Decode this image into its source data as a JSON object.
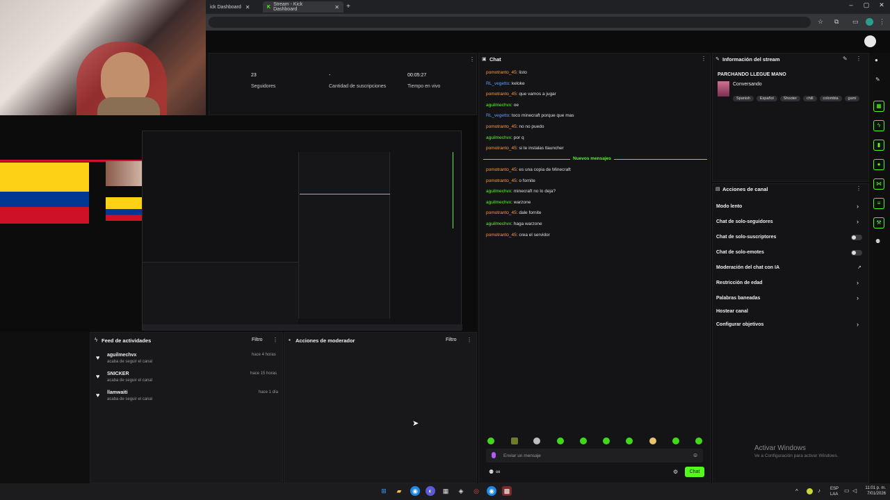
{
  "browser": {
    "tabs": [
      {
        "label": "ick Dashboard"
      },
      {
        "label": "Stream - Kick Dashboard"
      }
    ],
    "new_tab": "+",
    "controls": {
      "minimize": "–",
      "maximize": "▢",
      "close": "✕"
    }
  },
  "stats": {
    "followers_value": "23",
    "followers_label": "Seguidores",
    "subs_value": "-",
    "subs_label": "Cantidad de suscripciones",
    "live_time_value": "00:05:27",
    "live_time_label": "Tiempo en vivo"
  },
  "chat": {
    "title": "Chat",
    "new_messages_label": "Nuevos mensajes",
    "lines_before": [
      {
        "user": "pomotranto_45",
        "color": "orange",
        "text": "listo"
      },
      {
        "user": "RL_vegetto",
        "color": "blue",
        "text": "keloke"
      },
      {
        "user": "pomotranto_45",
        "color": "orange",
        "text": "que vamos a jugar"
      },
      {
        "user": "aguilmechvx",
        "color": "green",
        "text": "oe"
      },
      {
        "user": "RL_vegetto",
        "color": "blue",
        "text": "toco minecraft porque que mas"
      },
      {
        "user": "pomotranto_45",
        "color": "orange",
        "text": "no no puedo"
      },
      {
        "user": "aguilmechvx",
        "color": "green",
        "text": "por q"
      },
      {
        "user": "pomotranto_45",
        "color": "orange",
        "text": "si te instalas tlauncher"
      }
    ],
    "lines_after": [
      {
        "user": "pomotranto_45",
        "color": "orange",
        "text": "es una copia de Minecraft"
      },
      {
        "user": "pomotranto_45",
        "color": "orange",
        "text": "o fornite"
      },
      {
        "user": "aguilmechvx",
        "color": "green",
        "text": "minecraft no lo deja?"
      },
      {
        "user": "aguilmechvx",
        "color": "green",
        "text": "warzone"
      },
      {
        "user": "pomotranto_45",
        "color": "orange",
        "text": "dale fornite"
      },
      {
        "user": "aguilmechvx",
        "color": "green",
        "text": "haga warzone"
      },
      {
        "user": "pomotranto_45",
        "color": "orange",
        "text": "crea el servidor"
      }
    ],
    "input_placeholder": "Enviar un mensaje",
    "send_label": "Chat",
    "infinity": "∞"
  },
  "stream_info": {
    "title": "Información del stream",
    "stream_name": "PARCHANDO LLEGUE MANO",
    "category": "Conversando",
    "tags": [
      "Spanish",
      "Español",
      "Shooter",
      "chill",
      "colombia",
      "gami"
    ]
  },
  "channel_actions": {
    "title": "Acciones de canal",
    "items": [
      {
        "label": "Modo lento",
        "control": "chevron"
      },
      {
        "label": "Chat de solo-seguidores",
        "control": "chevron"
      },
      {
        "label": "Chat de solo-suscriptores",
        "control": "toggle"
      },
      {
        "label": "Chat de solo-emotes",
        "control": "toggle"
      },
      {
        "label": "Moderación del chat con IA",
        "control": "external"
      },
      {
        "label": "Restricción de edad",
        "control": "chevron"
      },
      {
        "label": "Palabras baneadas",
        "control": "chevron"
      },
      {
        "label": "Hostear canal",
        "control": "none"
      },
      {
        "label": "Configurar objetivos",
        "control": "chevron"
      }
    ]
  },
  "activity_feed": {
    "title": "Feed de actividades",
    "filter": "Filtro",
    "items": [
      {
        "name": "aguilmechvx",
        "action": "acaba de seguir el canal",
        "time": "hace 4 horas"
      },
      {
        "name": "SNICKER",
        "action": "acaba de seguir el canal",
        "time": "hace 15 horas"
      },
      {
        "name": "llamwaiti",
        "action": "acaba de seguir el canal",
        "time": "hace 1 día"
      }
    ]
  },
  "mod_actions": {
    "title": "Acciones de moderador",
    "filter": "Filtro"
  },
  "windows_watermark": {
    "line1": "Activar Windows",
    "line2": "Ve a Configuración para activar Windows."
  },
  "taskbar": {
    "lang": "ESP",
    "lang2": "LAA",
    "time": "11:01 p. m.",
    "date": "7/01/2026"
  },
  "colors": {
    "kick_green": "#53fc18",
    "orange_user": "#ff9a3c",
    "blue_user": "#5aa0ff",
    "panel_bg": "#18181b"
  }
}
